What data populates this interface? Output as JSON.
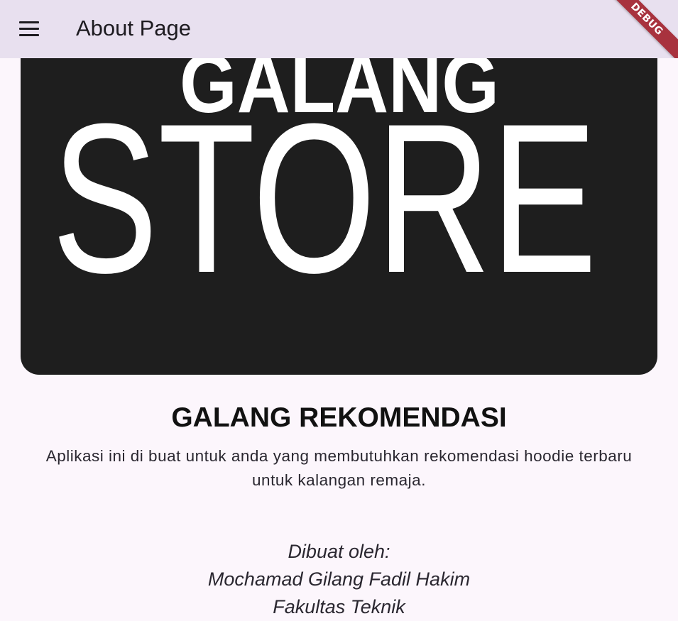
{
  "app_bar": {
    "title": "About Page",
    "menu_icon": "menu-icon",
    "debug_label": "DEBUG"
  },
  "hero": {
    "logo_line1": "GALANG",
    "logo_line2": "STORE"
  },
  "content": {
    "heading": "GALANG REKOMENDASI",
    "description": "Aplikasi ini di buat untuk anda yang membutuhkan rekomendasi hoodie terbaru untuk kalangan remaja.",
    "credits": {
      "label": "Dibuat oleh:",
      "author": "Mochamad Gilang Fadil Hakim",
      "faculty": "Fakultas Teknik"
    }
  },
  "colors": {
    "app_bar_bg": "#e8e0ef",
    "page_bg": "#fcf6fc",
    "hero_bg": "#1e1e1e",
    "debug_banner": "#a8323e"
  }
}
